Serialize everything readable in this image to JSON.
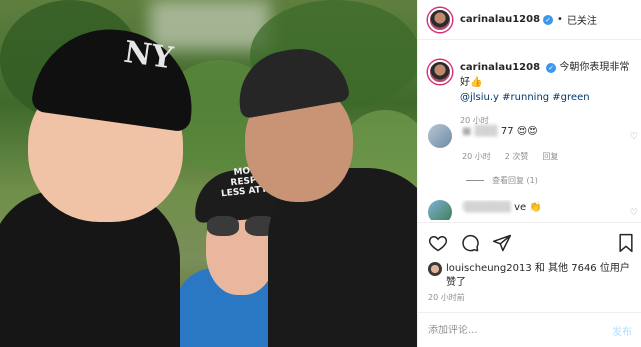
{
  "photo": {
    "cap_logo": "NY",
    "cap_text": "MONEY RESPECT LESS ATTACK"
  },
  "header": {
    "username": "carinalau1208",
    "follow_status": "已关注"
  },
  "caption": {
    "username": "carinalau1208",
    "text": "今朝你表現非常好👍",
    "tags": "@jlsiu.y #running #green",
    "time": "20 小时"
  },
  "comments": [
    {
      "text_visible": "77 😍😍",
      "time": "20 小时",
      "likes": "2 次赞",
      "reply_label": "回复"
    },
    {
      "text_visible": "ve 👏"
    }
  ],
  "view_replies": "查看回复 (1)",
  "likes": {
    "text": "louischeung2013 和 其他 7646 位用户赞了"
  },
  "post_time": "20 小时前",
  "add_comment": {
    "placeholder": "添加评论...",
    "post_label": "发布"
  }
}
